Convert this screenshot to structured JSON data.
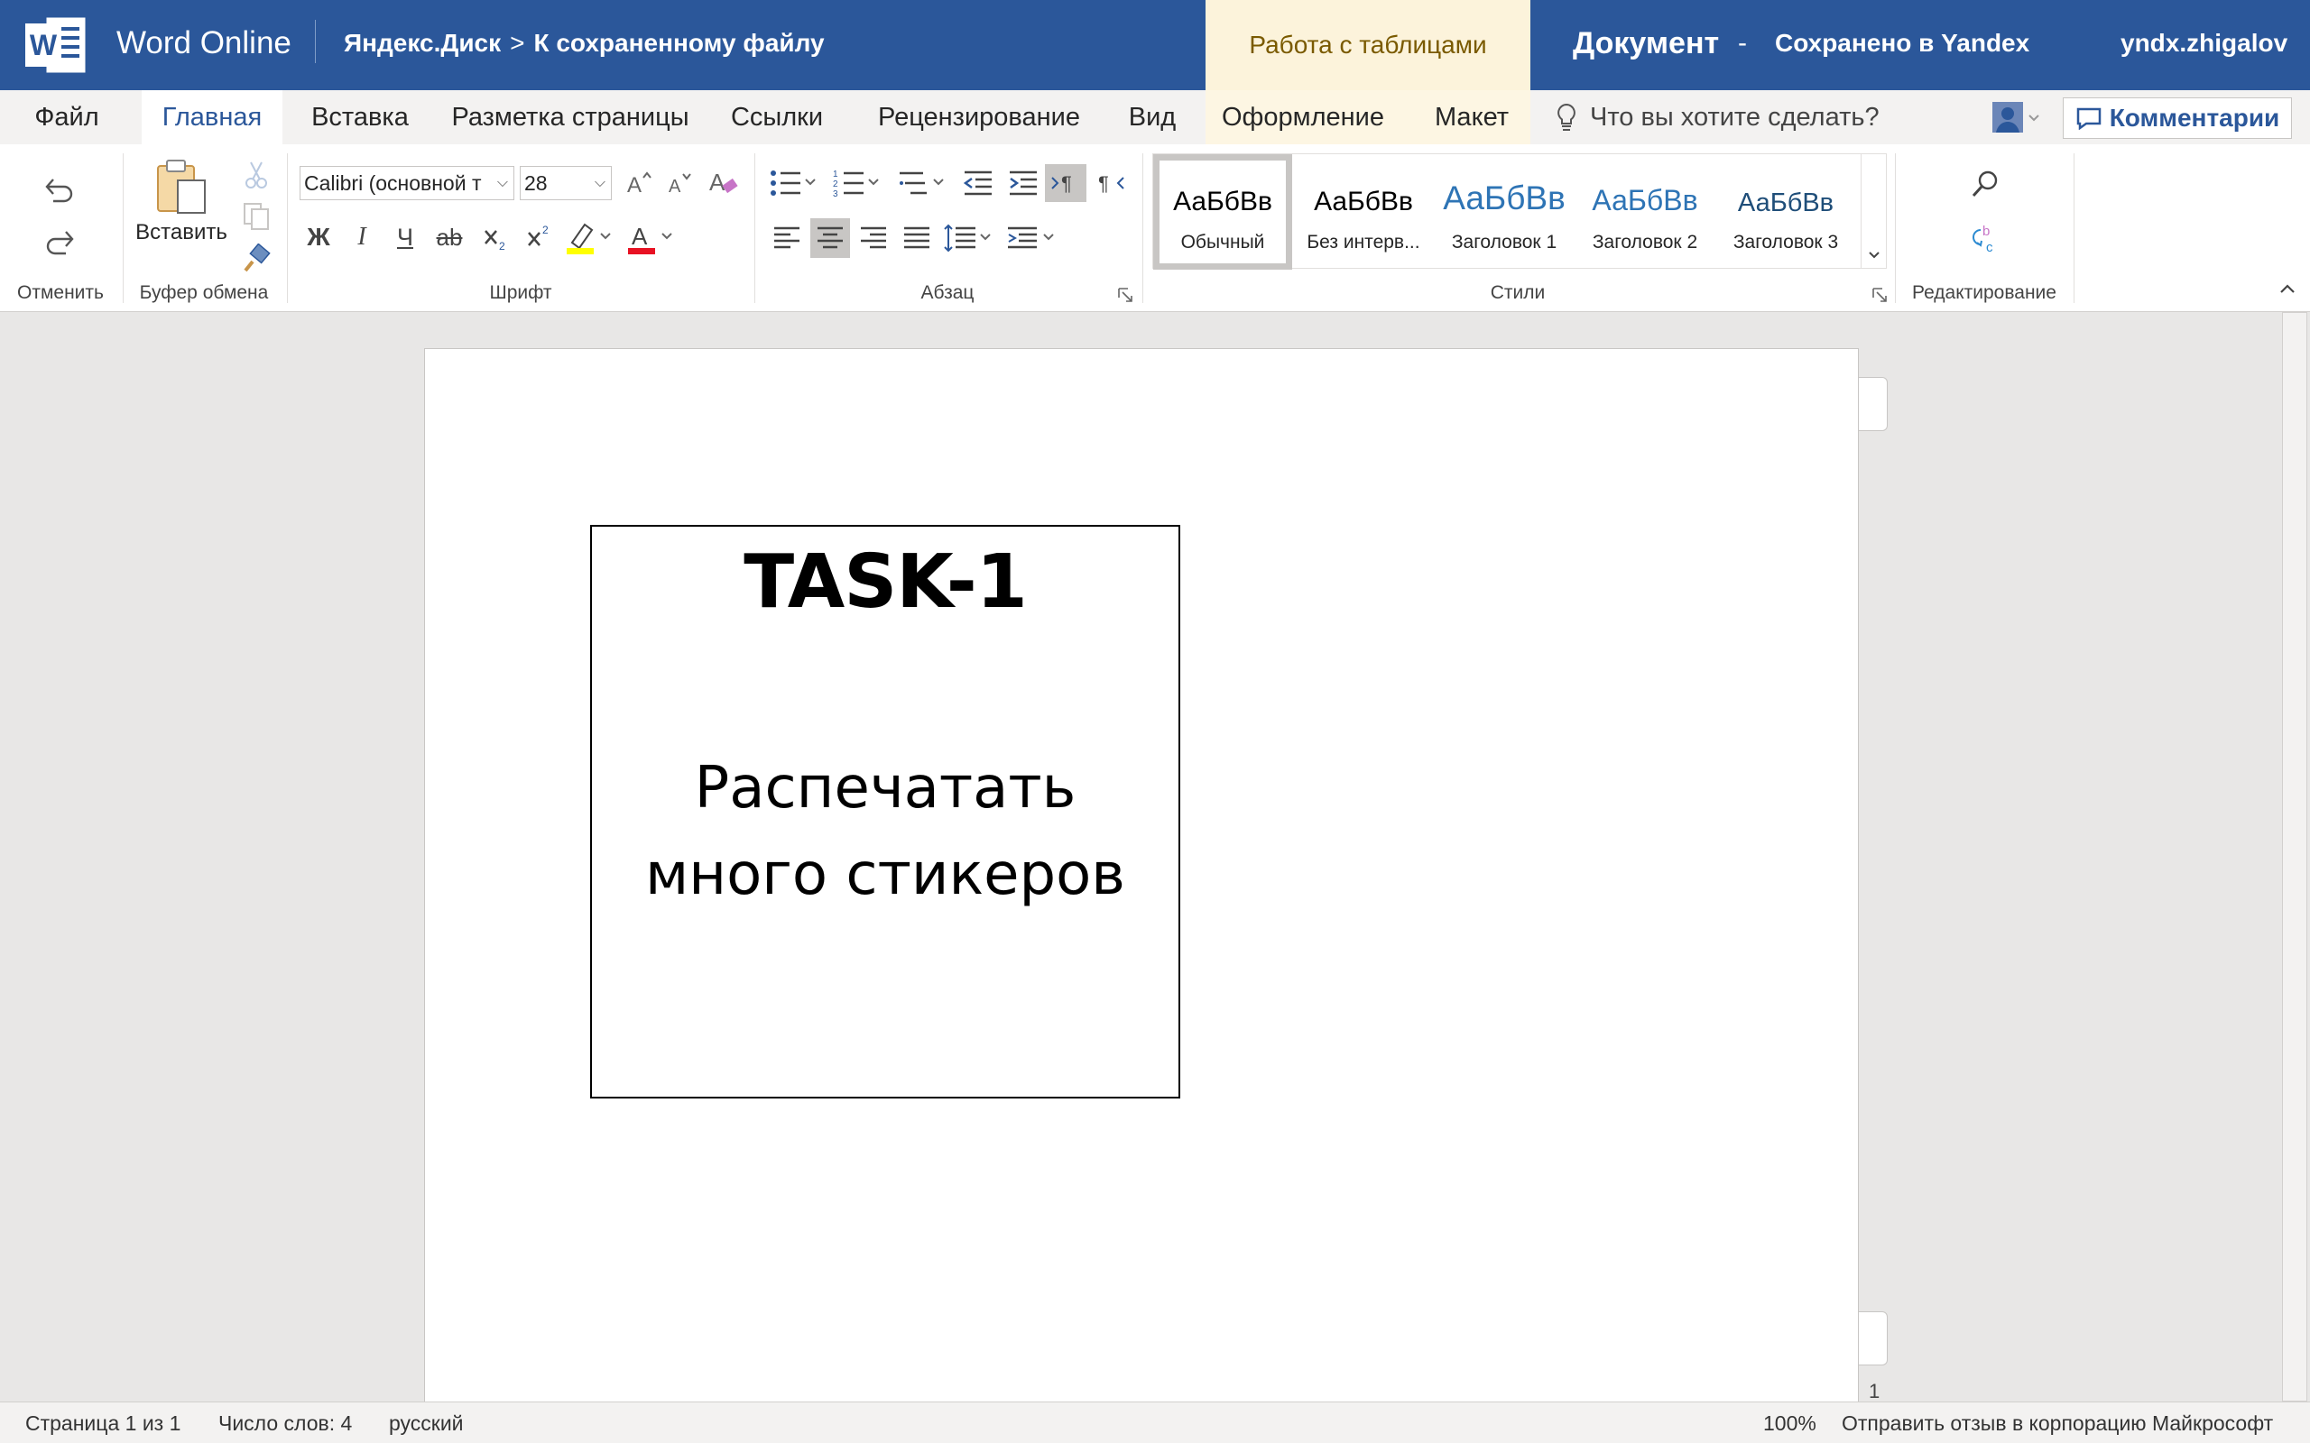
{
  "titlebar": {
    "app_name": "Word Online",
    "breadcrumb_root": "Яндекс.Диск",
    "breadcrumb_sep": ">",
    "breadcrumb_current": "К сохраненному файлу",
    "context_tab": "Работа с таблицами",
    "document_name": "Документ",
    "dash": "-",
    "save_status": "Сохранено в Yandex",
    "user": "yndx.zhigalov",
    "logo_letter": "W"
  },
  "tabs": {
    "file": "Файл",
    "home": "Главная",
    "insert": "Вставка",
    "layout": "Разметка страницы",
    "references": "Ссылки",
    "review": "Рецензирование",
    "view": "Вид",
    "design": "Оформление",
    "table_layout": "Макет",
    "tell_me": "Что вы хотите сделать?",
    "comments": "Комментарии"
  },
  "ribbon": {
    "undo_group": "Отменить",
    "clipboard_group": "Буфер обмена",
    "paste_label": "Вставить",
    "font_group": "Шрифт",
    "font_name": "Calibri (основной т",
    "font_size": "28",
    "bold": "Ж",
    "italic": "I",
    "underline": "Ч",
    "strike": "ab",
    "paragraph_group": "Абзац",
    "styles_group": "Стили",
    "editing_group": "Редактирование",
    "styles": [
      {
        "sample": "АаБбВв",
        "name": "Обычный"
      },
      {
        "sample": "АаБбВв",
        "name": "Без интерв..."
      },
      {
        "sample": "АаБбВв",
        "name": "Заголовок 1"
      },
      {
        "sample": "АаБбВв",
        "name": "Заголовок 2"
      },
      {
        "sample": "АаБбВв",
        "name": "Заголовок 3"
      }
    ]
  },
  "document": {
    "sticker_title": "TASK-1",
    "sticker_line1": "Распечатать",
    "sticker_line2": "много стикеров",
    "page_number": "1"
  },
  "statusbar": {
    "page": "Страница 1 из 1",
    "words": "Число слов: 4",
    "language": "русский",
    "zoom": "100%",
    "feedback": "Отправить отзыв в корпорацию Майкрософт"
  },
  "colors": {
    "brand": "#2b579a",
    "context_tab_bg": "#fcf3db",
    "workspace": "#e8e7e6"
  }
}
